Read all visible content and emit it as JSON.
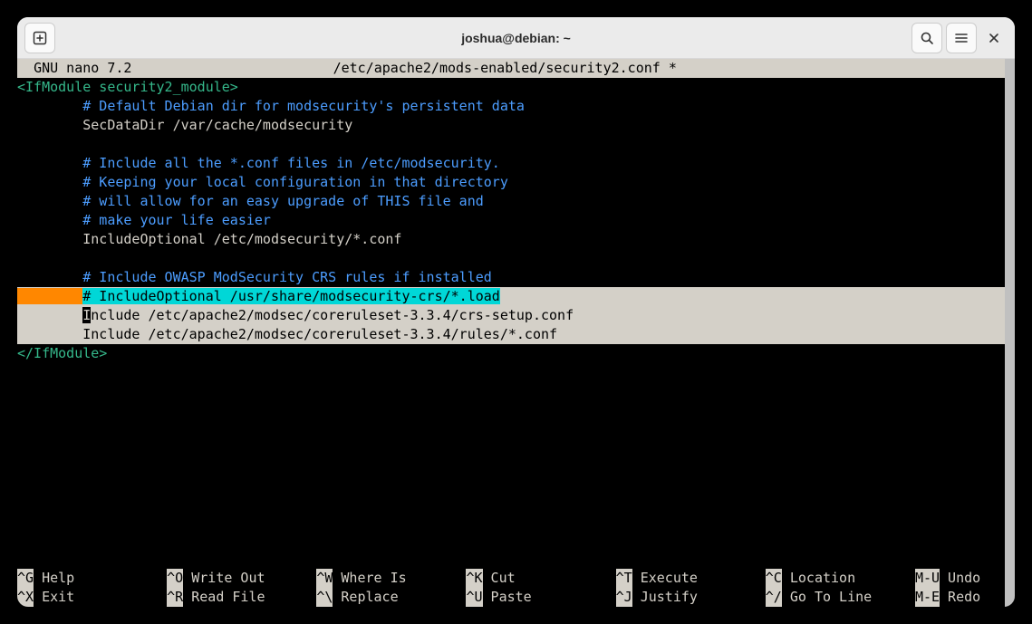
{
  "window": {
    "title": "joshua@debian: ~"
  },
  "nano": {
    "app": "GNU nano 7.2",
    "filepath": "/etc/apache2/mods-enabled/security2.conf *"
  },
  "content": {
    "l1": "<IfModule security2_module>",
    "l2": "# Default Debian dir for modsecurity's persistent data",
    "l3": "SecDataDir /var/cache/modsecurity",
    "l4": "# Include all the *.conf files in /etc/modsecurity.",
    "l5": "# Keeping your local configuration in that directory",
    "l6": "# will allow for an easy upgrade of THIS file and",
    "l7": "# make your life easier",
    "l8": "IncludeOptional /etc/modsecurity/*.conf",
    "l9": "# Include OWASP ModSecurity CRS rules if installed",
    "l10": "# IncludeOptional /usr/share/modsecurity-crs/*.load",
    "l11a": "I",
    "l11b": "nclude /etc/apache2/modsec/coreruleset-3.3.4/crs-setup.conf",
    "l12": "Include /etc/apache2/modsec/coreruleset-3.3.4/rules/*.conf",
    "l13": "</IfModule>"
  },
  "shortcuts": {
    "row1": [
      {
        "key": "^G",
        "label": " Help"
      },
      {
        "key": "^O",
        "label": " Write Out"
      },
      {
        "key": "^W",
        "label": " Where Is"
      },
      {
        "key": "^K",
        "label": " Cut"
      },
      {
        "key": "^T",
        "label": " Execute"
      },
      {
        "key": "^C",
        "label": " Location"
      },
      {
        "key": "M-U",
        "label": " Undo"
      }
    ],
    "row2": [
      {
        "key": "^X",
        "label": " Exit"
      },
      {
        "key": "^R",
        "label": " Read File"
      },
      {
        "key": "^\\",
        "label": " Replace"
      },
      {
        "key": "^U",
        "label": " Paste"
      },
      {
        "key": "^J",
        "label": " Justify"
      },
      {
        "key": "^/",
        "label": " Go To Line"
      },
      {
        "key": "M-E",
        "label": " Redo"
      }
    ]
  }
}
